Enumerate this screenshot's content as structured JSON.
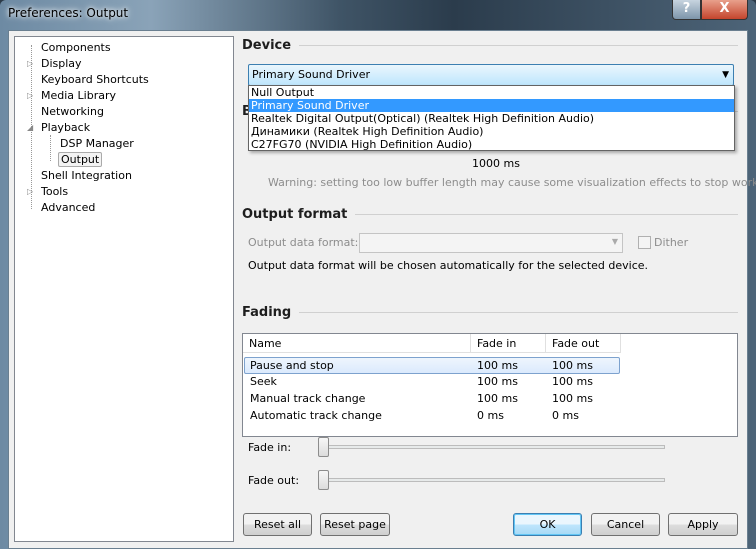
{
  "window": {
    "title": "Preferences: Output",
    "help": "?",
    "close": "X"
  },
  "tree": [
    {
      "label": "Components",
      "expander": ""
    },
    {
      "label": "Display",
      "expander": "▷"
    },
    {
      "label": "Keyboard Shortcuts",
      "expander": ""
    },
    {
      "label": "Media Library",
      "expander": "▷"
    },
    {
      "label": "Networking",
      "expander": ""
    },
    {
      "label": "Playback",
      "expander": "◢"
    },
    {
      "label": "DSP Manager",
      "expander": ""
    },
    {
      "label": "Output",
      "expander": "",
      "selected": true
    },
    {
      "label": "Shell Integration",
      "expander": ""
    },
    {
      "label": "Tools",
      "expander": "▷"
    },
    {
      "label": "Advanced",
      "expander": ""
    }
  ],
  "device": {
    "heading": "Device",
    "selected": "Primary Sound Driver",
    "options": [
      "Null Output",
      "Primary Sound Driver",
      "Realtek Digital Output(Optical) (Realtek High Definition Audio)",
      "Динамики (Realtek High Definition Audio)",
      "C27FG70 (NVIDIA High Definition Audio)"
    ],
    "hidden_heading_fragment": "B"
  },
  "buffer": {
    "value": "1000 ms",
    "warning": "Warning: setting too low buffer length may cause some visualization effects to stop working."
  },
  "output_format": {
    "heading": "Output format",
    "label": "Output data format:",
    "value": "",
    "dither": "Dither",
    "dither_checked": false,
    "info": "Output data format will be chosen automatically for the selected device."
  },
  "fading": {
    "heading": "Fading",
    "columns": [
      "Name",
      "Fade in",
      "Fade out"
    ],
    "rows": [
      [
        "Pause and stop",
        "100 ms",
        "100 ms"
      ],
      [
        "Seek",
        "100 ms",
        "100 ms"
      ],
      [
        "Manual track change",
        "100 ms",
        "100 ms"
      ],
      [
        "Automatic track change",
        "0 ms",
        "0 ms"
      ]
    ],
    "fade_in_label": "Fade in:",
    "fade_out_label": "Fade out:",
    "fade_in_value": 0,
    "fade_out_value": 0
  },
  "buttons": {
    "reset_all": "Reset all",
    "reset_page": "Reset page",
    "ok": "OK",
    "cancel": "Cancel",
    "apply": "Apply"
  }
}
